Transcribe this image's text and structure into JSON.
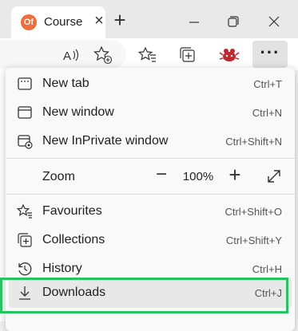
{
  "tab": {
    "title": "Course",
    "favicon_text": "Of"
  },
  "menu": {
    "items": [
      {
        "label": "New tab",
        "shortcut": "Ctrl+T"
      },
      {
        "label": "New window",
        "shortcut": "Ctrl+N"
      },
      {
        "label": "New InPrivate window",
        "shortcut": "Ctrl+Shift+N"
      }
    ],
    "zoom": {
      "label": "Zoom",
      "value": "100%"
    },
    "items2": [
      {
        "label": "Favourites",
        "shortcut": "Ctrl+Shift+O"
      },
      {
        "label": "Collections",
        "shortcut": "Ctrl+Shift+Y"
      },
      {
        "label": "History",
        "shortcut": "Ctrl+H"
      },
      {
        "label": "Downloads",
        "shortcut": "Ctrl+J"
      }
    ]
  },
  "colors": {
    "highlight_border": "#22c55e",
    "favicon_bg": "#f26b3a"
  },
  "icons": [
    "favicon",
    "close-icon",
    "plus-icon",
    "minimize-icon",
    "restore-icon",
    "close-window-icon",
    "read-aloud-icon",
    "add-favorite-icon",
    "favorites-icon",
    "collections-icon",
    "extension-icon",
    "more-icon"
  ]
}
